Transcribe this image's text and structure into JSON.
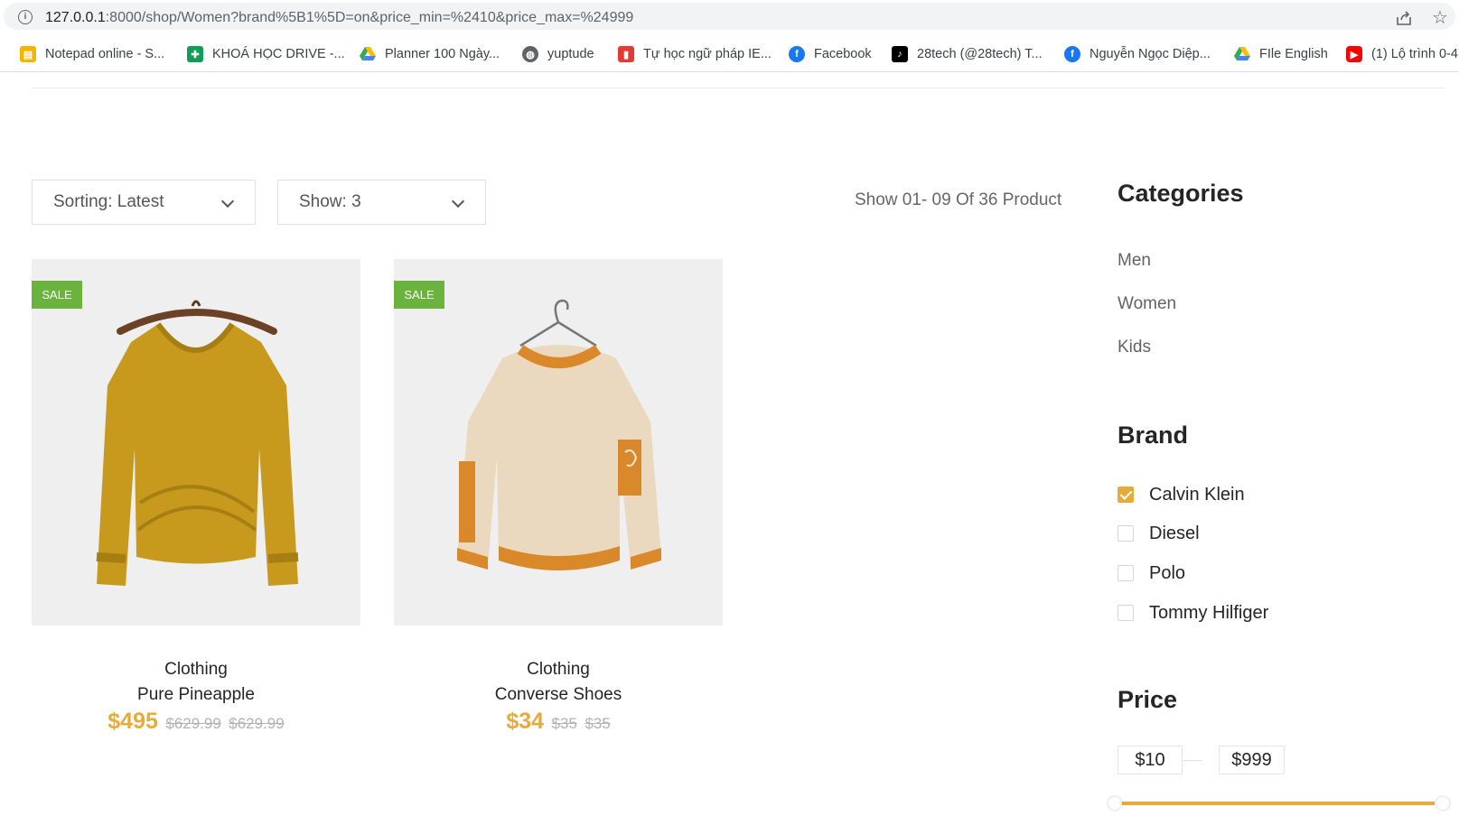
{
  "browser": {
    "url_host": "127.0.0.1",
    "url_rest": ":8000/shop/Women?brand%5B1%5D=on&price_min=%2410&price_max=%24999",
    "bookmarks": [
      {
        "label": "Notepad online - S...",
        "icon": "notepad-icon",
        "color": "#f4b400"
      },
      {
        "label": "KHOÁ HỌC DRIVE -...",
        "icon": "sheets-icon",
        "color": "#0f9d58"
      },
      {
        "label": "Planner 100 Ngày...",
        "icon": "drive-icon",
        "color": "#4285f4"
      },
      {
        "label": "yuptude",
        "icon": "globe-icon",
        "color": "#5f6368"
      },
      {
        "label": "Tự học ngữ pháp IE...",
        "icon": "book-icon",
        "color": "#e53935"
      },
      {
        "label": "Facebook",
        "icon": "facebook-icon",
        "color": "#1877f2"
      },
      {
        "label": "28tech (@28tech) T...",
        "icon": "tiktok-icon",
        "color": "#000000"
      },
      {
        "label": "Nguyễn Ngọc Diệp...",
        "icon": "facebook-icon",
        "color": "#1877f2"
      },
      {
        "label": "FIle English",
        "icon": "drive-icon",
        "color": "#4285f4"
      },
      {
        "label": "(1) Lộ trình 0-4",
        "icon": "youtube-icon",
        "color": "#ff0000"
      }
    ]
  },
  "toolbar": {
    "sorting_label": "Sorting: Latest",
    "show_label": "Show: 3",
    "result_count": "Show 01- 09 Of 36 Product"
  },
  "products": [
    {
      "badge": "SALE",
      "category": "Clothing",
      "name": "Pure Pineapple",
      "price": "$495",
      "old_price_1": "$629.99",
      "old_price_2": "$629.99",
      "image": "yellow-sweater-image"
    },
    {
      "badge": "SALE",
      "category": "Clothing",
      "name": "Converse Shoes",
      "price": "$34",
      "old_price_1": "$35",
      "old_price_2": "$35",
      "image": "cream-sweater-image"
    }
  ],
  "sidebar": {
    "categories_title": "Categories",
    "categories": [
      "Men",
      "Women",
      "Kids"
    ],
    "brand_title": "Brand",
    "brands": [
      {
        "label": "Calvin Klein",
        "checked": true
      },
      {
        "label": "Diesel",
        "checked": false
      },
      {
        "label": "Polo",
        "checked": false
      },
      {
        "label": "Tommy Hilfiger",
        "checked": false
      }
    ],
    "price_title": "Price",
    "price_min": "$10",
    "price_max": "$999"
  },
  "colors": {
    "accent": "#e7ab3c",
    "sale_badge": "#6ab43e"
  }
}
